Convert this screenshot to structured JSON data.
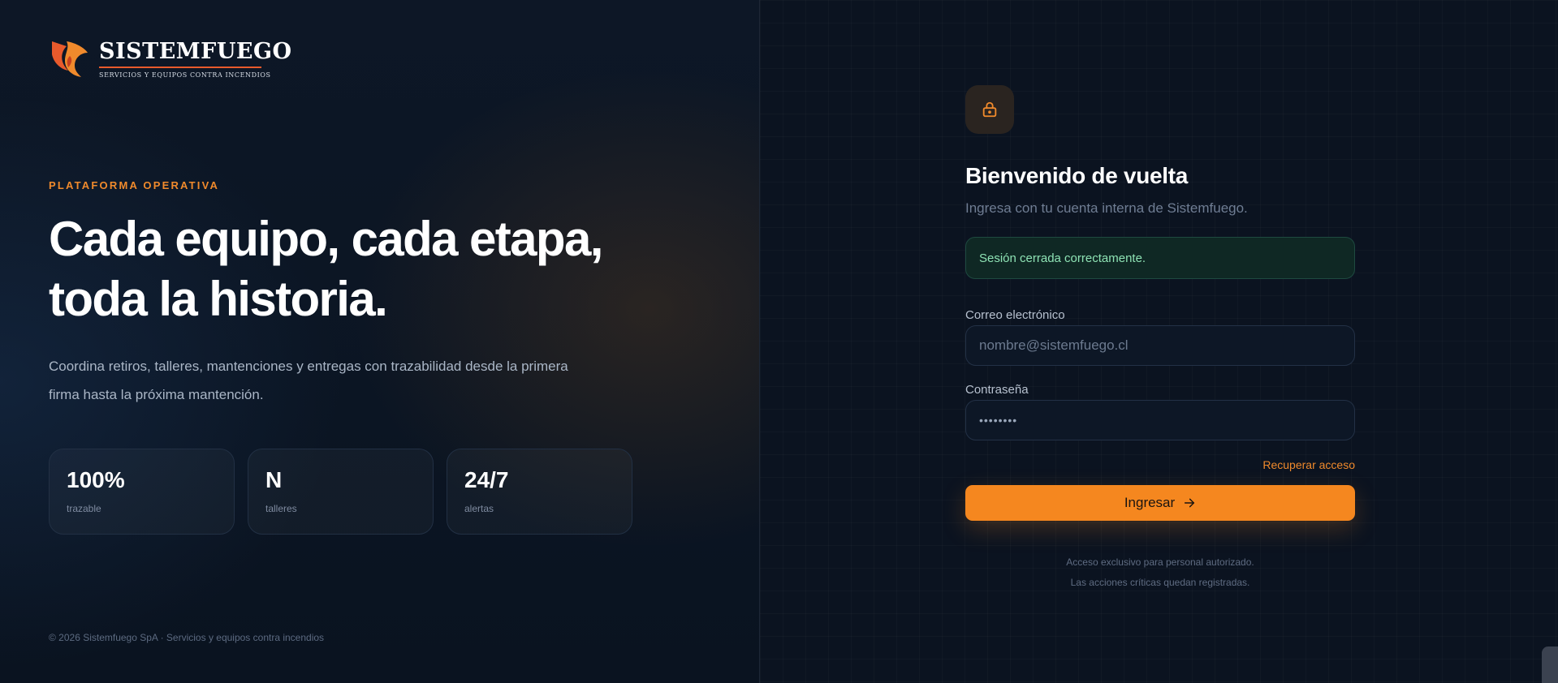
{
  "brand": {
    "name": "SISTEMFUEGO",
    "tagline": "SERVICIOS Y EQUIPOS CONTRA INCENDIOS",
    "colors": {
      "flame_primary": "#e85a2c",
      "flame_secondary": "#f08a2c"
    }
  },
  "hero": {
    "eyebrow": "PLATAFORMA OPERATIVA",
    "headline_line1": "Cada equipo, cada etapa,",
    "headline_line2": "toda la historia.",
    "subcopy": "Coordina retiros, talleres, mantenciones y entregas con trazabilidad desde la primera firma hasta la próxima mantención.",
    "stats": [
      {
        "value": "100%",
        "label": "trazable"
      },
      {
        "value": "N",
        "label": "talleres"
      },
      {
        "value": "24/7",
        "label": "alertas"
      }
    ],
    "footer": "© 2026 Sistemfuego SpA · Servicios y equipos contra incendios"
  },
  "login": {
    "lock_icon": "lock-icon",
    "title": "Bienvenido de vuelta",
    "subtitle": "Ingresa con tu cuenta interna de Sistemfuego.",
    "alert": "Sesión cerrada correctamente.",
    "email_label": "Correo electrónico",
    "email_placeholder": "nombre@sistemfuego.cl",
    "password_label": "Contraseña",
    "password_value": "••••••••",
    "recover_link": "Recuperar acceso",
    "submit_label": "Ingresar",
    "submit_icon": "arrow-right-icon",
    "notice_line1": "Acceso exclusivo para personal autorizado.",
    "notice_line2": "Las acciones críticas quedan registradas."
  },
  "colors": {
    "accent": "#f5871f",
    "background": "#0b1422",
    "success_text": "#8ee2b4"
  }
}
